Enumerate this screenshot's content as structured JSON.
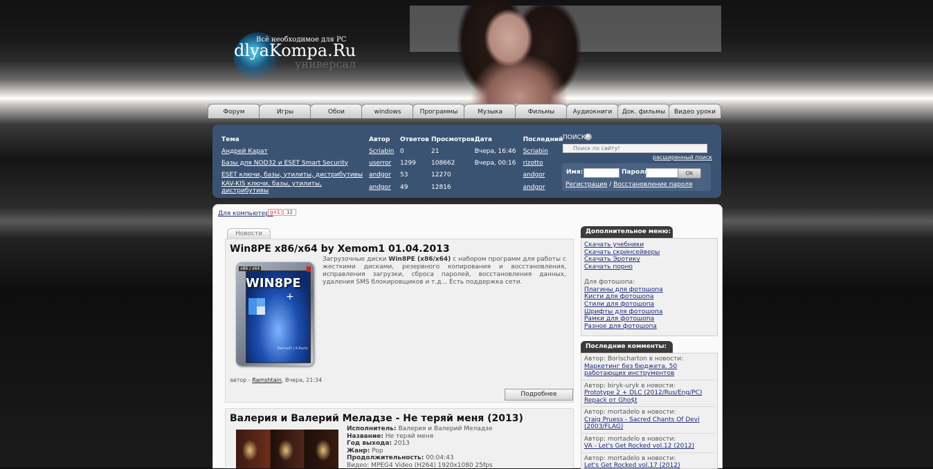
{
  "header": {
    "tagline": "Всё необходимое для PC",
    "site_name": "dlyaKompa.Ru",
    "site_sub": "универсал"
  },
  "tabs": [
    "Форум",
    "Игры",
    "Обои",
    "windows",
    "Программы",
    "Музыка",
    "Фильмы",
    "Аудиокниги",
    "Док. фильмы",
    "Видео уроки"
  ],
  "forum": {
    "headers": [
      "Тема",
      "Автор",
      "Ответов",
      "Просмотров",
      "Дата",
      "Последний"
    ],
    "rows": [
      {
        "topic": "Андрей Карат",
        "author": "Scriabin",
        "replies": "0",
        "views": "21",
        "date": "Вчера, 16:46",
        "last": "Scriabin"
      },
      {
        "topic": "Базы для NOD32 и ESET Smart Security",
        "author": "userror",
        "replies": "1299",
        "views": "108662",
        "date": "Вчера, 00:16",
        "last": "rizotto"
      },
      {
        "topic": "ESET ключи, базы, утилиты, дистрибутивы",
        "author": "andgor",
        "replies": "53",
        "views": "12270",
        "date": "",
        "last": "andgor"
      },
      {
        "topic": "KAV-KIS ключи, базы, утилиты, дистрибутивы",
        "author": "andgor",
        "replies": "49",
        "views": "12816",
        "date": "",
        "last": "andgor"
      }
    ]
  },
  "search": {
    "title": "ПОИСК",
    "placeholder": "Поиск по сайту!",
    "advanced": "расширенный поиск"
  },
  "login": {
    "name_label": "Имя:",
    "password_label": "Пароль:",
    "ok": "Ok",
    "register": "Регистрация",
    "separator": "/",
    "recover": "Восстановление пароля"
  },
  "main": {
    "breadcrumb": "Для компьютера",
    "gplus": "g+1",
    "share_count": "12",
    "news_tab": "Новости"
  },
  "news": [
    {
      "title": "Win8PE x86/x64 by Xemom1 01.04.2013",
      "thumb_title": "WIN8PE",
      "thumb_plus": "+",
      "thumb_bits": "x86 / x64",
      "thumb_footer": "Ramsoft | A.Pavlo",
      "desc_pre": "Загрузочные диски ",
      "desc_bold": "Win8PE (x86/x64)",
      "desc_post": " с набором программ для работы с жесткими дисками, резервного копирования и восстановления, исправления загрузки, сброса паролей, восстановления данных, удаления SMS блокировщиков и т.д... Есть поддержка сети.",
      "meta_prefix": "автор - ",
      "meta_author": "Ramshtain",
      "meta_date": ", Вчера, 21:34",
      "more": "Подробнее"
    },
    {
      "title": "Валерия и Валерий Меладзе - Не теряй меня (2013)",
      "fields": [
        {
          "label": "Исполнитель:",
          "value": "Валерия и Валерий Меладзе"
        },
        {
          "label": "Название:",
          "value": "Не теряй меня"
        },
        {
          "label": "Год выхода:",
          "value": "2013"
        },
        {
          "label": "Жанр:",
          "value": "Pop"
        },
        {
          "label": "Продолжительность:",
          "value": "00:04:43"
        }
      ],
      "extra_line": "Видео: MPEG4 Video (H264) 1920x1080 25fps"
    }
  ],
  "sidebar": {
    "menu_title": "Дополнительное меню:",
    "menu_links": [
      "Скачать учебники",
      "Скачать скринсейверы",
      "Скачать Эротику",
      "Скачать порно"
    ],
    "photoshop_label": "Для фотошопа:",
    "photoshop_links": [
      "Плагины для фотошопа",
      "Кисти для фотошопа",
      "Стили для фотошопа",
      "Шрифты для фотошопа",
      "Рамки для фотошопа",
      "Разное для фотошопа"
    ],
    "comments_title": "Последние комменты:",
    "comments": [
      {
        "meta": "Автор: Borischarton в новости:",
        "link": "Маркетинг без бюджета. 50 работающих инструментов"
      },
      {
        "meta": "Автор: biryk-uryk в новости:",
        "link": "Prototype 2 + DLC (2012/Rus/Eng/PC) Repack от Gho$t"
      },
      {
        "meta": "Автор: mortadelo в новости:",
        "link": "Craig Pruess - Sacred Chants Of Devi (2003/FLAG)"
      },
      {
        "meta": "Автор: mortadelo в новости:",
        "link": "VA - Let's Get Rocked vol.12 (2012)"
      },
      {
        "meta": "Автор: mortadelo в новости:",
        "link": "Let's Get Rocked vol.17 (2012)"
      }
    ]
  },
  "colors": {
    "panel": "#3b5373",
    "link": "#1e2a7a",
    "sidebar_tab": "#3b3b3b"
  }
}
